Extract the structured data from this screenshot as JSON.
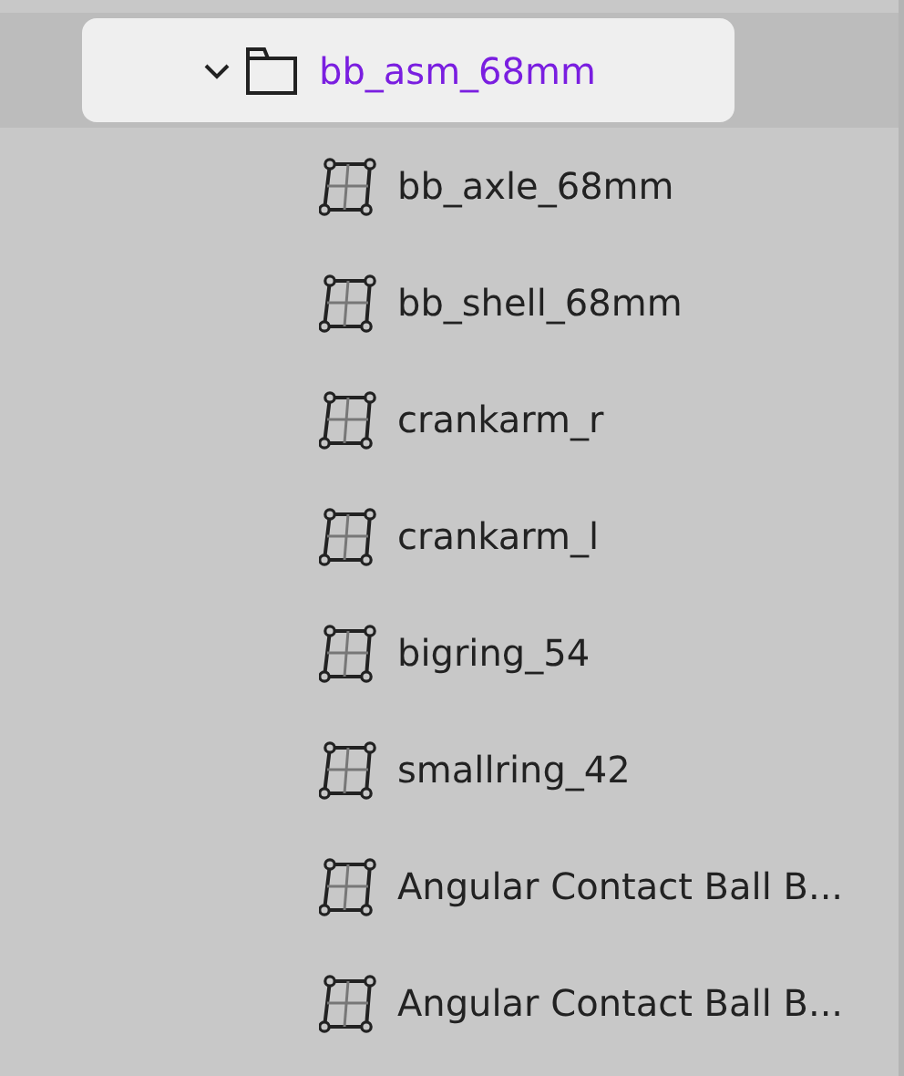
{
  "tree": {
    "label": "bb_asm_68mm",
    "expanded": true,
    "selected": true,
    "children": [
      {
        "label": "bb_axle_68mm"
      },
      {
        "label": "bb_shell_68mm"
      },
      {
        "label": "crankarm_r"
      },
      {
        "label": "crankarm_l"
      },
      {
        "label": "bigring_54"
      },
      {
        "label": "smallring_42"
      },
      {
        "label": "Angular Contact Ball B..."
      },
      {
        "label": "Angular Contact Ball B..."
      }
    ]
  }
}
